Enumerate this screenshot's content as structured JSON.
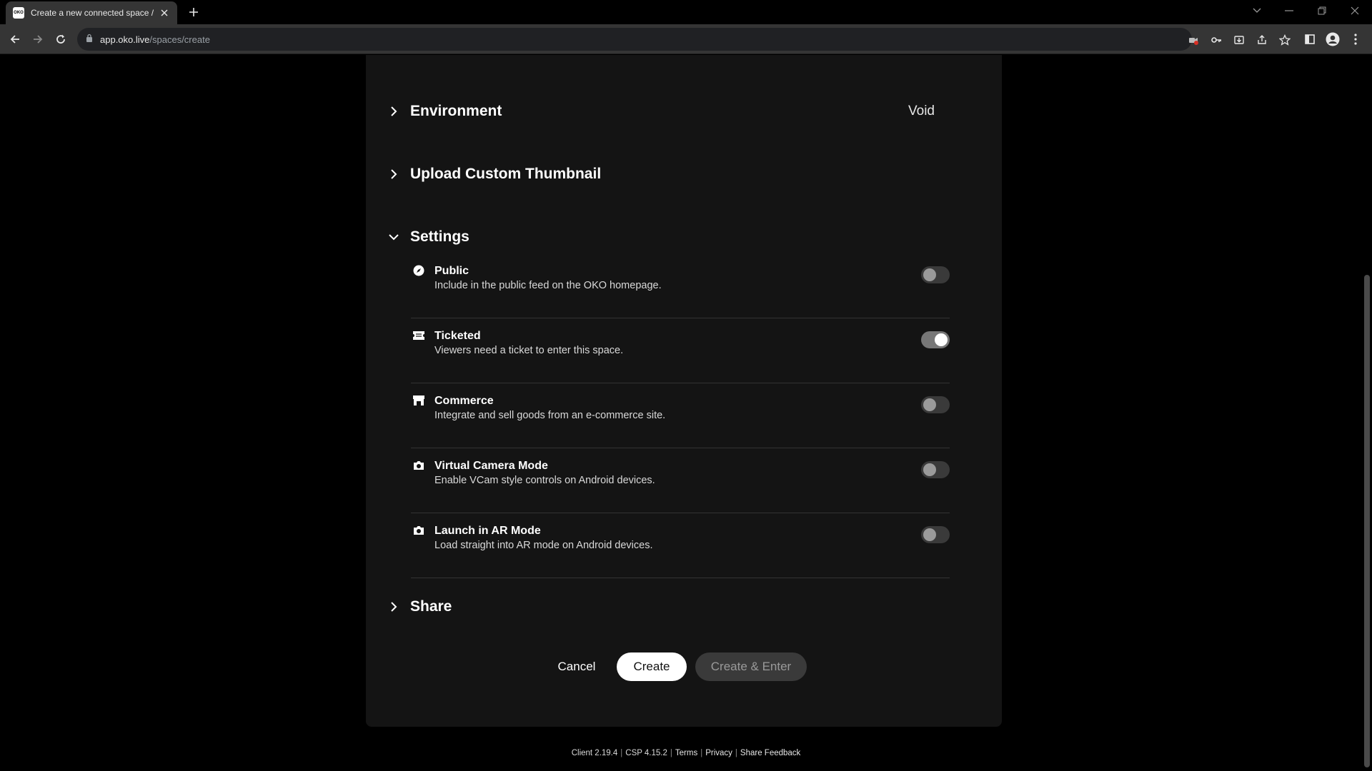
{
  "browser": {
    "tab_title": "Create a new connected space / OKO",
    "favicon_text": "OKO",
    "url_host": "app.oko.live",
    "url_path": "/spaces/create"
  },
  "sections": {
    "environment": {
      "title": "Environment",
      "value": "Void"
    },
    "thumbnail": {
      "title": "Upload Custom Thumbnail"
    },
    "settings": {
      "title": "Settings"
    },
    "share": {
      "title": "Share"
    }
  },
  "settings": [
    {
      "title": "Public",
      "description": "Include in the public feed on the OKO homepage.",
      "icon": "compass-icon",
      "enabled": false
    },
    {
      "title": "Ticketed",
      "description": "Viewers need a ticket to enter this space.",
      "icon": "ticket-icon",
      "enabled": true
    },
    {
      "title": "Commerce",
      "description": "Integrate and sell goods from an e-commerce site.",
      "icon": "storefront-icon",
      "enabled": false
    },
    {
      "title": "Virtual Camera Mode",
      "description": "Enable VCam style controls on Android devices.",
      "icon": "camera-icon",
      "enabled": false
    },
    {
      "title": "Launch in AR Mode",
      "description": "Load straight into AR mode on Android devices.",
      "icon": "camera-icon",
      "enabled": false
    }
  ],
  "actions": {
    "cancel": "Cancel",
    "create": "Create",
    "create_enter": "Create & Enter"
  },
  "footer": {
    "client": "Client 2.19.4",
    "csp": "CSP 4.15.2",
    "terms": "Terms",
    "privacy": "Privacy",
    "feedback": "Share Feedback"
  }
}
